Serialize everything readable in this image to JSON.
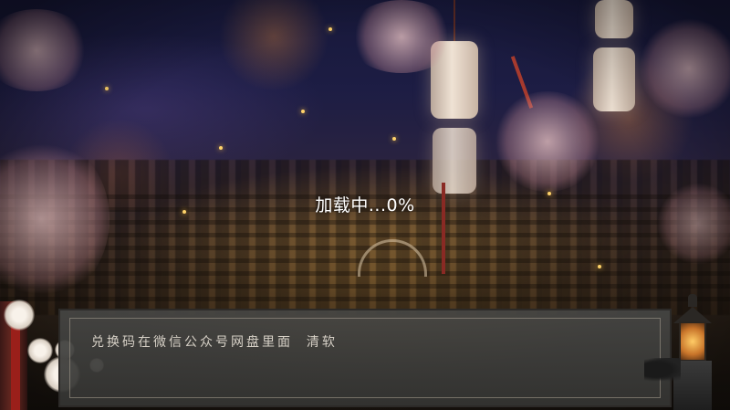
{
  "loading": {
    "label": "加载中...0%",
    "progress_percent": 0
  },
  "dialog": {
    "message": "兑换码在微信公众号网盘里面  清软"
  },
  "colors": {
    "loading_text": "#ffffff",
    "dialog_text": "#d6d0c6",
    "dialog_background": "#4a4a48"
  }
}
